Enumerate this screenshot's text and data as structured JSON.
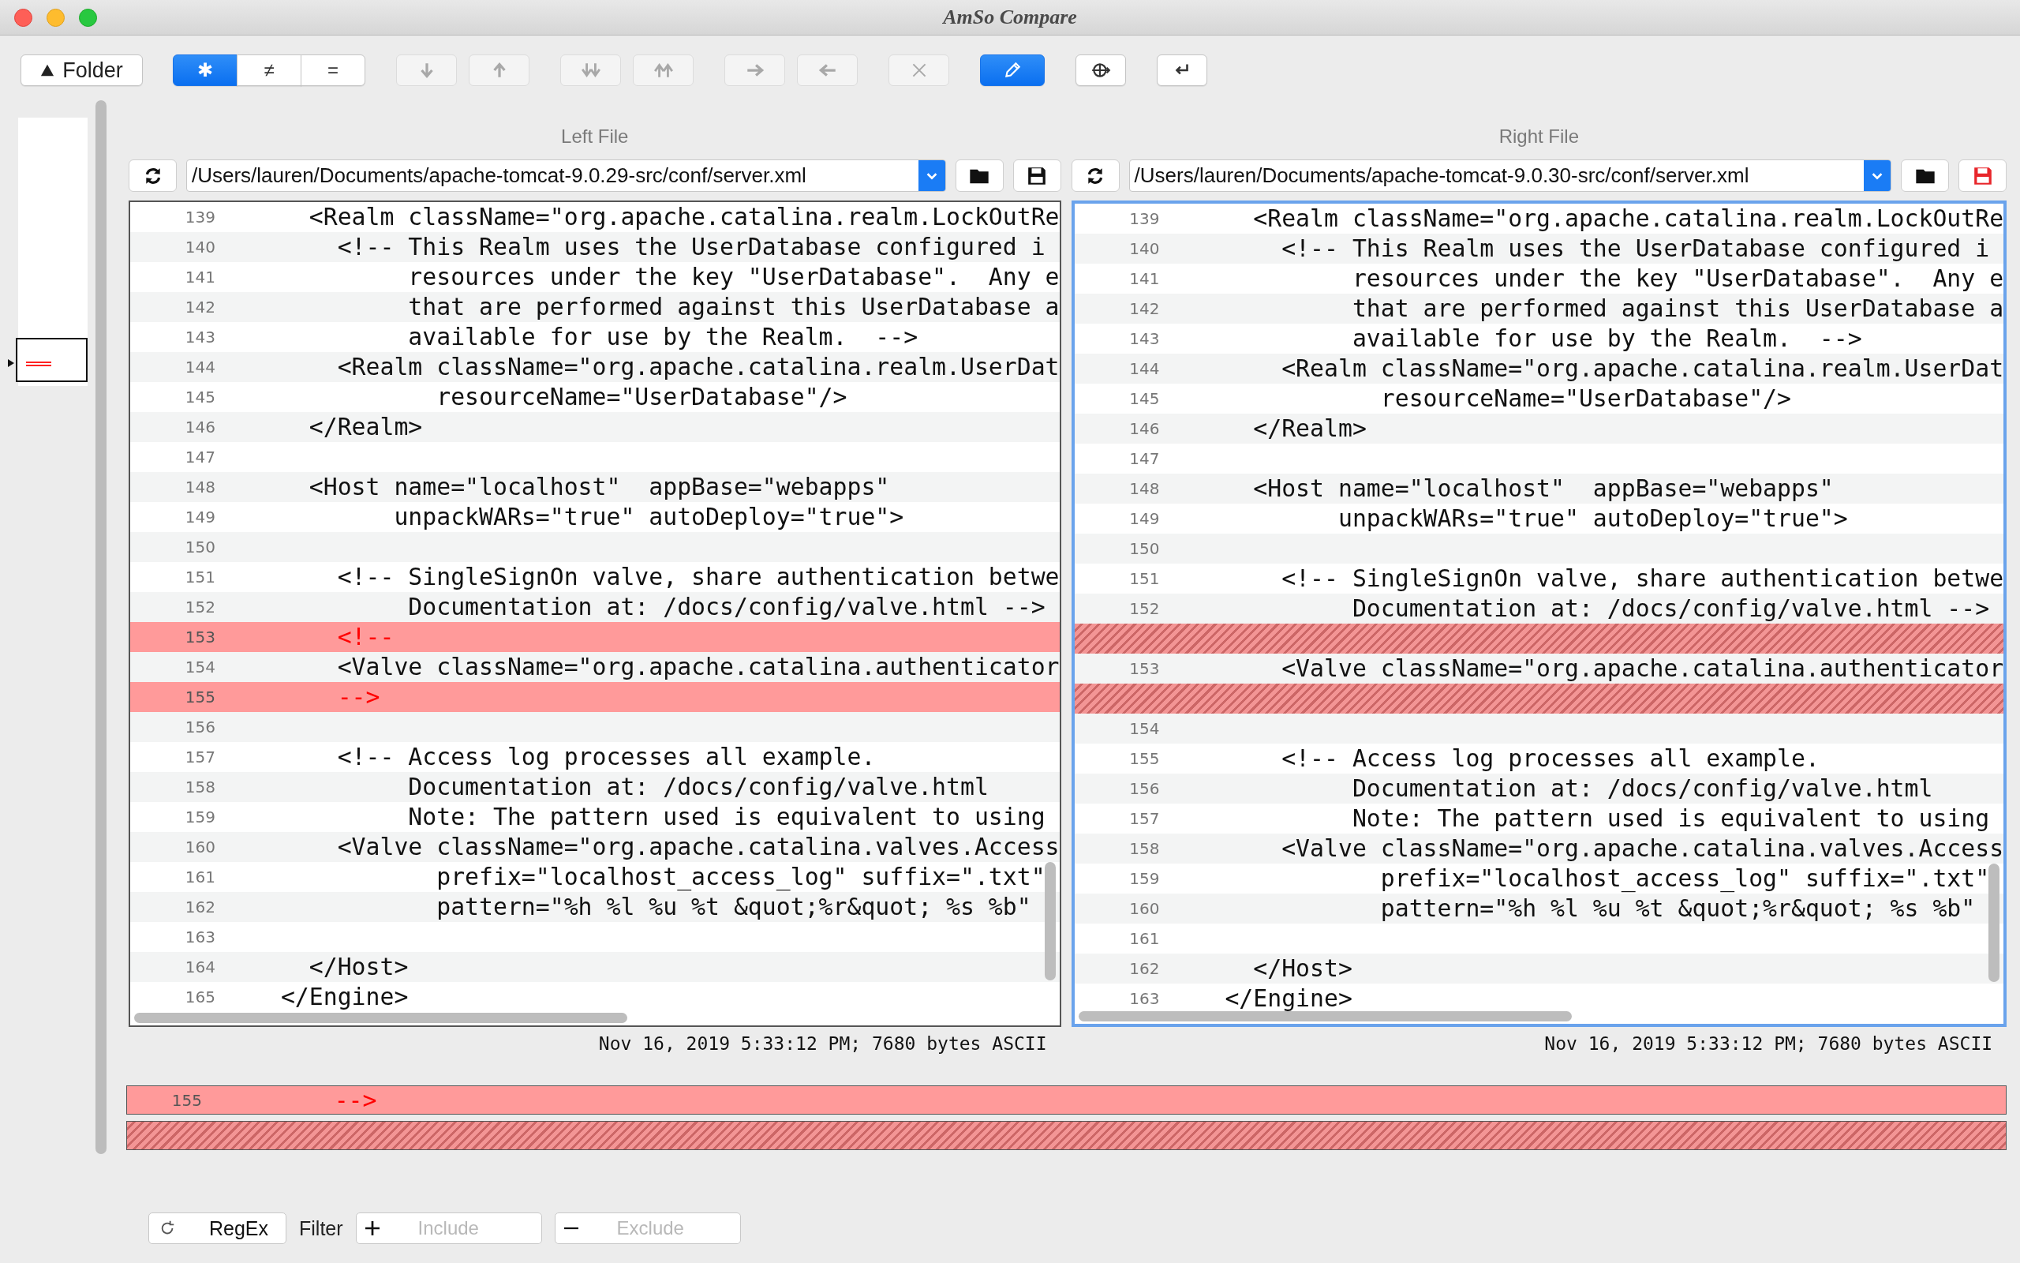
{
  "window": {
    "title": "AmSo Compare"
  },
  "toolbar": {
    "folder_button": {
      "label": "Folder"
    },
    "compare_modes": [
      {
        "label": "✱",
        "selected": true
      },
      {
        "label": "≠",
        "selected": false
      },
      {
        "label": "=",
        "selected": false
      }
    ],
    "buttons": [
      {
        "kind": "down",
        "disabled": true,
        "on": false
      },
      {
        "kind": "up",
        "disabled": true,
        "on": false
      },
      {
        "kind": "last",
        "disabled": true,
        "on": false
      },
      {
        "kind": "first",
        "disabled": true,
        "on": false
      },
      {
        "kind": "right",
        "disabled": true,
        "on": false
      },
      {
        "kind": "left",
        "disabled": true,
        "on": false
      },
      {
        "kind": "clear",
        "disabled": true,
        "on": false
      },
      {
        "kind": "edit",
        "disabled": false,
        "on": true
      },
      {
        "kind": "web",
        "disabled": false,
        "on": false
      },
      {
        "kind": "return",
        "disabled": false,
        "on": false
      }
    ]
  },
  "panes": [
    {
      "heading": "Left File",
      "path": "/Users/lauren/Documents/apache-tomcat-9.0.29-src/conf/server.xml",
      "focused": false,
      "unsaved": false,
      "status": "Nov 16, 2019 5:33:12 PM; 7680 bytes ASCII",
      "rows": [
        {
          "kind": "same",
          "number": "139",
          "text": "    <Realm className=\"org.apache.catalina.realm.LockOutRe"
        },
        {
          "kind": "same",
          "number": "140",
          "text": "      <!-- This Realm uses the UserDatabase configured i"
        },
        {
          "kind": "same",
          "number": "141",
          "text": "           resources under the key \"UserDatabase\".  Any e"
        },
        {
          "kind": "same",
          "number": "142",
          "text": "           that are performed against this UserDatabase a"
        },
        {
          "kind": "same",
          "number": "143",
          "text": "           available for use by the Realm.  -->"
        },
        {
          "kind": "same",
          "number": "144",
          "text": "      <Realm className=\"org.apache.catalina.realm.UserDat"
        },
        {
          "kind": "same",
          "number": "145",
          "text": "             resourceName=\"UserDatabase\"/>"
        },
        {
          "kind": "same",
          "number": "146",
          "text": "    </Realm>"
        },
        {
          "kind": "same",
          "number": "147"
        },
        {
          "kind": "same",
          "number": "148",
          "text": "    <Host name=\"localhost\"  appBase=\"webapps\""
        },
        {
          "kind": "same",
          "number": "149",
          "text": "          unpackWARs=\"true\" autoDeploy=\"true\">"
        },
        {
          "kind": "same",
          "number": "150"
        },
        {
          "kind": "same",
          "number": "151",
          "text": "      <!-- SingleSignOn valve, share authentication betwe"
        },
        {
          "kind": "same",
          "number": "152",
          "text": "           Documentation at: /docs/config/valve.html -->"
        },
        {
          "kind": "changed",
          "number": "153",
          "text": "      <!--"
        },
        {
          "kind": "same",
          "number": "154",
          "text": "      <Valve className=\"org.apache.catalina.authenticator"
        },
        {
          "kind": "changed",
          "number": "155",
          "text": "      -->"
        },
        {
          "kind": "same",
          "number": "156"
        },
        {
          "kind": "same",
          "number": "157",
          "text": "      <!-- Access log processes all example."
        },
        {
          "kind": "same",
          "number": "158",
          "text": "           Documentation at: /docs/config/valve.html"
        },
        {
          "kind": "same",
          "number": "159",
          "text": "           Note: The pattern used is equivalent to using"
        },
        {
          "kind": "same",
          "number": "160",
          "text": "      <Valve className=\"org.apache.catalina.valves.Access"
        },
        {
          "kind": "same",
          "number": "161",
          "text": "             prefix=\"localhost_access_log\" suffix=\".txt\""
        },
        {
          "kind": "same",
          "number": "162",
          "text": "             pattern=\"%h %l %u %t &quot;%r&quot; %s %b\""
        },
        {
          "kind": "same",
          "number": "163"
        },
        {
          "kind": "same",
          "number": "164",
          "text": "    </Host>"
        },
        {
          "kind": "same",
          "number": "165",
          "text": "  </Engine>"
        }
      ]
    },
    {
      "heading": "Right File",
      "path": "/Users/lauren/Documents/apache-tomcat-9.0.30-src/conf/server.xml",
      "focused": true,
      "unsaved": true,
      "status": "Nov 16, 2019 5:33:12 PM; 7680 bytes ASCII",
      "rows": [
        {
          "kind": "same",
          "number": "139",
          "text": "    <Realm className=\"org.apache.catalina.realm.LockOutRe"
        },
        {
          "kind": "same",
          "number": "140",
          "text": "      <!-- This Realm uses the UserDatabase configured i"
        },
        {
          "kind": "same",
          "number": "141",
          "text": "           resources under the key \"UserDatabase\".  Any e"
        },
        {
          "kind": "same",
          "number": "142",
          "text": "           that are performed against this UserDatabase a"
        },
        {
          "kind": "same",
          "number": "143",
          "text": "           available for use by the Realm.  -->"
        },
        {
          "kind": "same",
          "number": "144",
          "text": "      <Realm className=\"org.apache.catalina.realm.UserDat"
        },
        {
          "kind": "same",
          "number": "145",
          "text": "             resourceName=\"UserDatabase\"/>"
        },
        {
          "kind": "same",
          "number": "146",
          "text": "    </Realm>"
        },
        {
          "kind": "same",
          "number": "147"
        },
        {
          "kind": "same",
          "number": "148",
          "text": "    <Host name=\"localhost\"  appBase=\"webapps\""
        },
        {
          "kind": "same",
          "number": "149",
          "text": "          unpackWARs=\"true\" autoDeploy=\"true\">"
        },
        {
          "kind": "same",
          "number": "150"
        },
        {
          "kind": "same",
          "number": "151",
          "text": "      <!-- SingleSignOn valve, share authentication betwe"
        },
        {
          "kind": "same",
          "number": "152",
          "text": "           Documentation at: /docs/config/valve.html -->"
        },
        {
          "kind": "gap"
        },
        {
          "kind": "same",
          "number": "153",
          "text": "      <Valve className=\"org.apache.catalina.authenticator"
        },
        {
          "kind": "gap"
        },
        {
          "kind": "same",
          "number": "154"
        },
        {
          "kind": "same",
          "number": "155",
          "text": "      <!-- Access log processes all example."
        },
        {
          "kind": "same",
          "number": "156",
          "text": "           Documentation at: /docs/config/valve.html"
        },
        {
          "kind": "same",
          "number": "157",
          "text": "           Note: The pattern used is equivalent to using"
        },
        {
          "kind": "same",
          "number": "158",
          "text": "      <Valve className=\"org.apache.catalina.valves.Access"
        },
        {
          "kind": "same",
          "number": "159",
          "text": "             prefix=\"localhost_access_log\" suffix=\".txt\""
        },
        {
          "kind": "same",
          "number": "160",
          "text": "             pattern=\"%h %l %u %t &quot;%r&quot; %s %b\""
        },
        {
          "kind": "same",
          "number": "161"
        },
        {
          "kind": "same",
          "number": "162",
          "text": "    </Host>"
        },
        {
          "kind": "same",
          "number": "163",
          "text": "  </Engine>"
        }
      ]
    }
  ],
  "detail": {
    "rows": [
      {
        "kind": "changed",
        "number": "155",
        "text": "      -->"
      },
      {
        "kind": "gap"
      }
    ]
  },
  "filter": {
    "regex_button": {
      "label": "RegEx"
    },
    "label": "Filter",
    "include": {
      "placeholder": "Include"
    },
    "exclude": {
      "placeholder": "Exclude"
    }
  }
}
